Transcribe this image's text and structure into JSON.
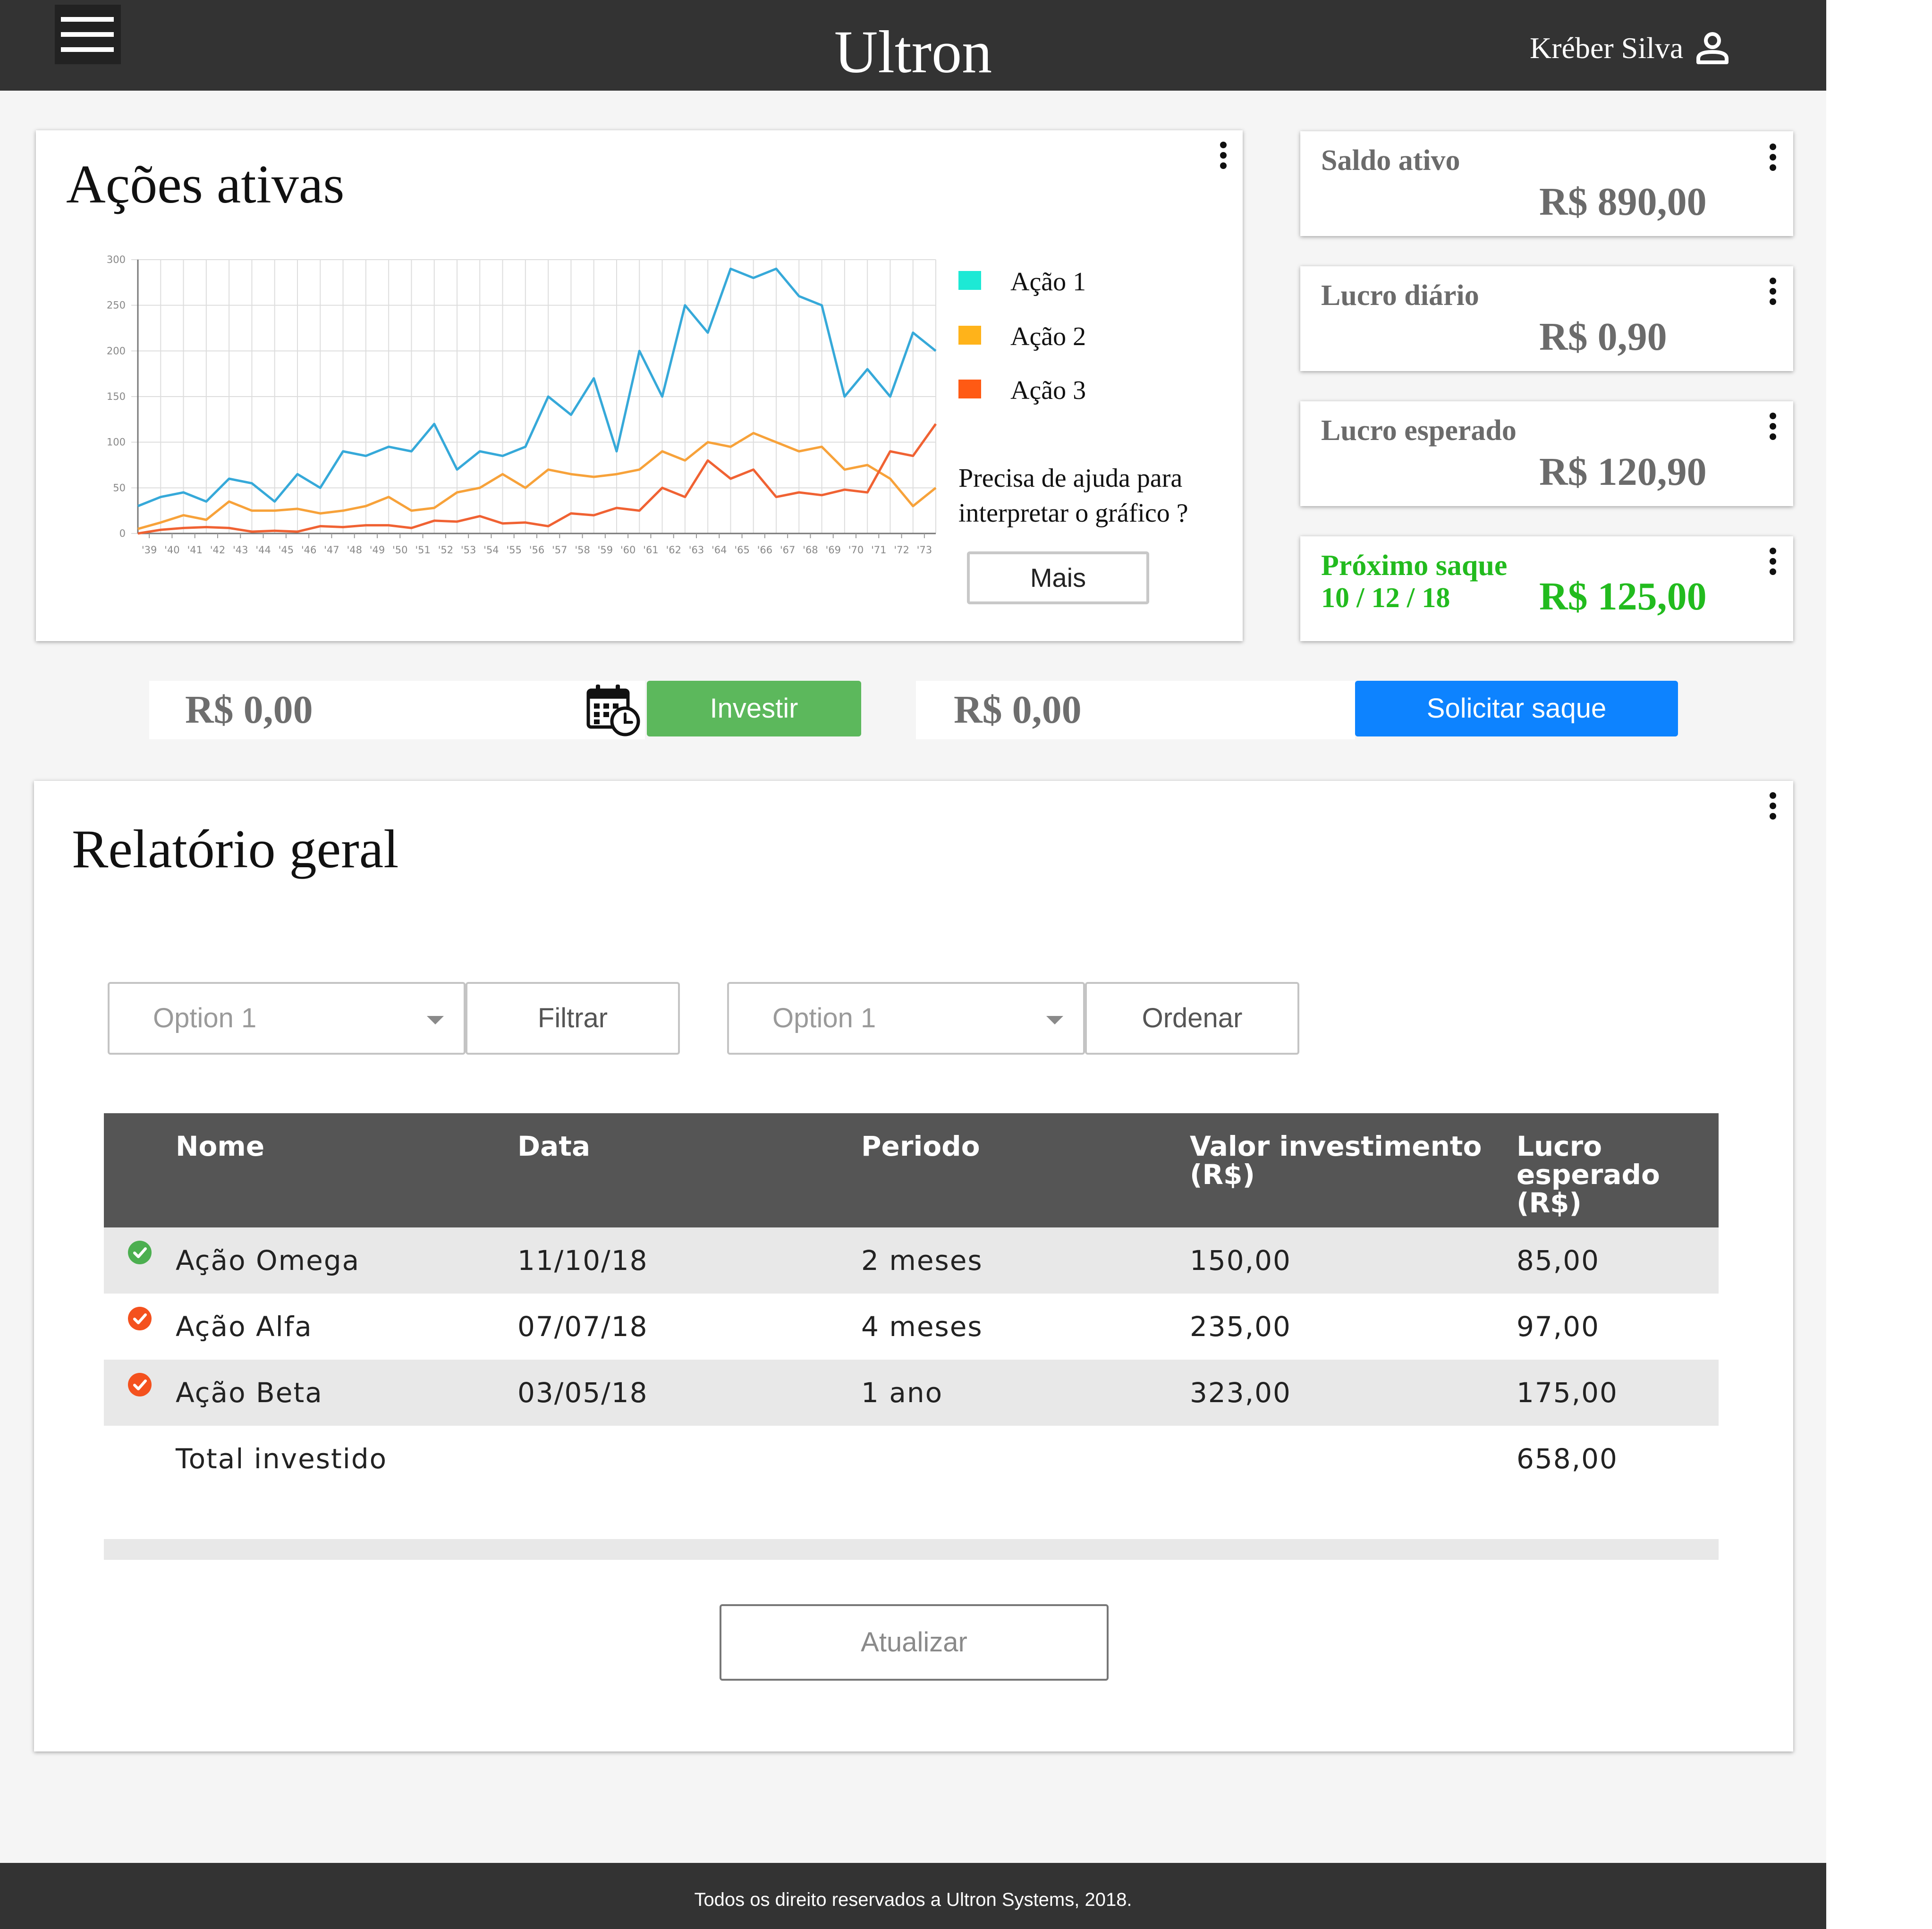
{
  "header": {
    "app_title": "Ultron",
    "user_name": "Kréber Silva",
    "menu_icon": "hamburger-menu-icon",
    "user_icon": "user-icon"
  },
  "chart_card": {
    "title": "Ações ativas",
    "help_text": "Precisa de ajuda para interpretar o gráfico ?",
    "more_button": "Mais"
  },
  "chart_data": {
    "type": "line",
    "title": "",
    "xlabel": "",
    "ylabel": "",
    "x": [
      "'39",
      "'40",
      "'41",
      "'42",
      "'43",
      "'44",
      "'45",
      "'46",
      "'47",
      "'48",
      "'49",
      "'50",
      "'51",
      "'52",
      "'53",
      "'54",
      "'55",
      "'56",
      "'57",
      "'58",
      "'59",
      "'60",
      "'61",
      "'62",
      "'63",
      "'64",
      "'65",
      "'66",
      "'67",
      "'68",
      "'69",
      "'70",
      "'71",
      "'72",
      "'73"
    ],
    "ylim": [
      0,
      300
    ],
    "yticks": [
      0,
      50,
      100,
      150,
      200,
      250,
      300
    ],
    "grid": true,
    "legend_position": "right",
    "series": [
      {
        "name": "Ação 1",
        "legend_color": "#1de9d5",
        "color": "#36a9d9",
        "values": [
          30,
          40,
          45,
          35,
          60,
          55,
          35,
          65,
          50,
          90,
          85,
          95,
          90,
          120,
          70,
          90,
          85,
          95,
          150,
          130,
          170,
          90,
          200,
          150,
          250,
          220,
          290,
          280,
          290,
          260,
          250,
          150,
          180,
          150,
          220,
          200
        ]
      },
      {
        "name": "Ação 2",
        "legend_color": "#ffb31a",
        "color": "#f7a23a",
        "values": [
          5,
          12,
          20,
          15,
          35,
          25,
          25,
          27,
          22,
          25,
          30,
          40,
          25,
          28,
          45,
          50,
          65,
          50,
          70,
          65,
          62,
          65,
          70,
          90,
          80,
          100,
          95,
          110,
          100,
          90,
          95,
          70,
          75,
          60,
          30,
          50
        ]
      },
      {
        "name": "Ação 3",
        "legend_color": "#ff5a14",
        "color": "#f06233",
        "values": [
          0,
          4,
          6,
          7,
          6,
          2,
          3,
          2,
          8,
          7,
          9,
          9,
          6,
          14,
          13,
          19,
          11,
          12,
          8,
          22,
          20,
          28,
          25,
          50,
          40,
          80,
          60,
          70,
          40,
          45,
          42,
          48,
          45,
          90,
          85,
          120
        ]
      }
    ]
  },
  "stats": [
    {
      "label": "Saldo ativo",
      "value": "R$ 890,00"
    },
    {
      "label": "Lucro diário",
      "value": "R$ 0,90"
    },
    {
      "label": "Lucro esperado",
      "value": "R$ 120,90"
    },
    {
      "label": "Próximo saque",
      "date": "10 / 12 / 18",
      "value": "R$ 125,00",
      "color": "#22bb1e"
    }
  ],
  "invest": {
    "amount": "R$ 0,00",
    "calendar_icon": "calendar-clock-icon",
    "button": "Investir",
    "button_color": "#5cb85c"
  },
  "withdraw": {
    "amount": "R$ 0,00",
    "button": "Solicitar saque",
    "button_color": "#0d83ff"
  },
  "report": {
    "title": "Relatório geral",
    "filter_select": "Option 1",
    "filter_button": "Filtrar",
    "order_select": "Option 1",
    "order_button": "Ordenar",
    "columns": [
      "Nome",
      "Data",
      "Periodo",
      "Valor investimento (R$)",
      "Lucro esperado (R$)"
    ],
    "rows": [
      {
        "status": "check-green-icon",
        "status_color": "#4caf50",
        "name": "Ação Omega",
        "date": "11/10/18",
        "period": "2 meses",
        "value": "150,00",
        "profit": "85,00"
      },
      {
        "status": "check-orange-icon",
        "status_color": "#f4511e",
        "name": "Ação Alfa",
        "date": "07/07/18",
        "period": "4 meses",
        "value": "235,00",
        "profit": "97,00"
      },
      {
        "status": "check-orange-icon",
        "status_color": "#f4511e",
        "name": "Ação Beta",
        "date": "03/05/18",
        "period": "1 ano",
        "value": "323,00",
        "profit": "175,00"
      }
    ],
    "total_label": "Total investido",
    "total_value": "658,00",
    "refresh_button": "Atualizar"
  },
  "footer": {
    "text": "Todos os direito reservados a Ultron Systems, 2018."
  }
}
